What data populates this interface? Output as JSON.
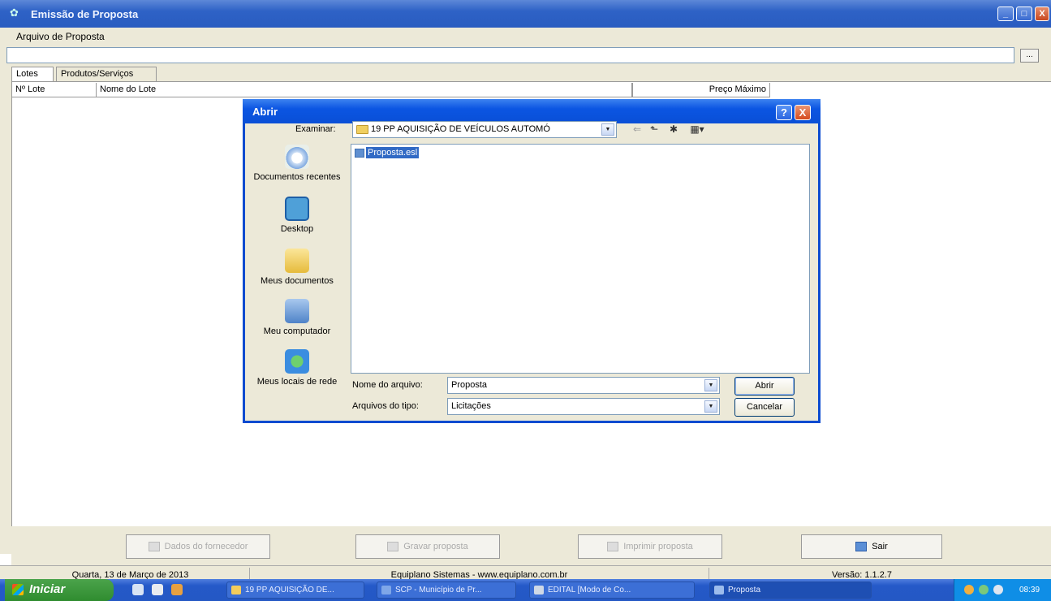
{
  "main_window": {
    "title": "Emissão de Proposta",
    "controls": {
      "minimize": "_",
      "maximize": "□",
      "close": "X"
    },
    "file_label": "Arquivo de Proposta",
    "file_value": "",
    "browse_label": "...",
    "tabs": [
      "Lotes",
      "Produtos/Serviços"
    ],
    "columns": [
      "Nº Lote",
      "Nome do Lote",
      "Preço Máximo"
    ],
    "buttons": {
      "dados": "Dados do fornecedor",
      "gravar": "Gravar proposta",
      "imprimir": "Imprimir proposta",
      "sair": "Sair"
    },
    "status": {
      "date": "Quarta, 13 de Março de 2013",
      "company": "Equiplano Sistemas - www.equiplano.com.br",
      "version": "Versão: 1.1.2.7"
    }
  },
  "dialog": {
    "title": "Abrir",
    "help": "?",
    "close": "X",
    "look_in_label": "Examinar:",
    "look_in_value": "19 PP AQUISIÇÃO DE VEÍCULOS AUTOMÓ",
    "places": [
      "Documentos recentes",
      "Desktop",
      "Meus documentos",
      "Meu computador",
      "Meus locais de rede"
    ],
    "files": [
      {
        "name": "Proposta.esl",
        "selected": true
      }
    ],
    "file_name_label": "Nome do arquivo:",
    "file_name_value": "Proposta",
    "file_type_label": "Arquivos do tipo:",
    "file_type_value": "Licitações",
    "open_button": "Abrir",
    "cancel_button": "Cancelar"
  },
  "taskbar": {
    "start_label": "Iniciar",
    "items": [
      "19 PP AQUISIÇÃO DE...",
      "SCP - Município de Pr...",
      "EDITAL [Modo de Co...",
      "Proposta"
    ],
    "clock": "08:39"
  },
  "icons": {
    "app": "app-icon",
    "folder": "folder-icon",
    "file": "file-icon",
    "back": "back-arrow-icon",
    "up": "folder-up-icon",
    "new_folder": "new-folder-icon",
    "view_menu": "view-menu-icon"
  },
  "colors": {
    "title_blue": "#2e62c6",
    "dialog_blue": "#0b55e2",
    "window_bg": "#ece9d8",
    "selection": "#316ac5",
    "start_green": "#3a973a",
    "tray_blue": "#0f8ee6"
  }
}
